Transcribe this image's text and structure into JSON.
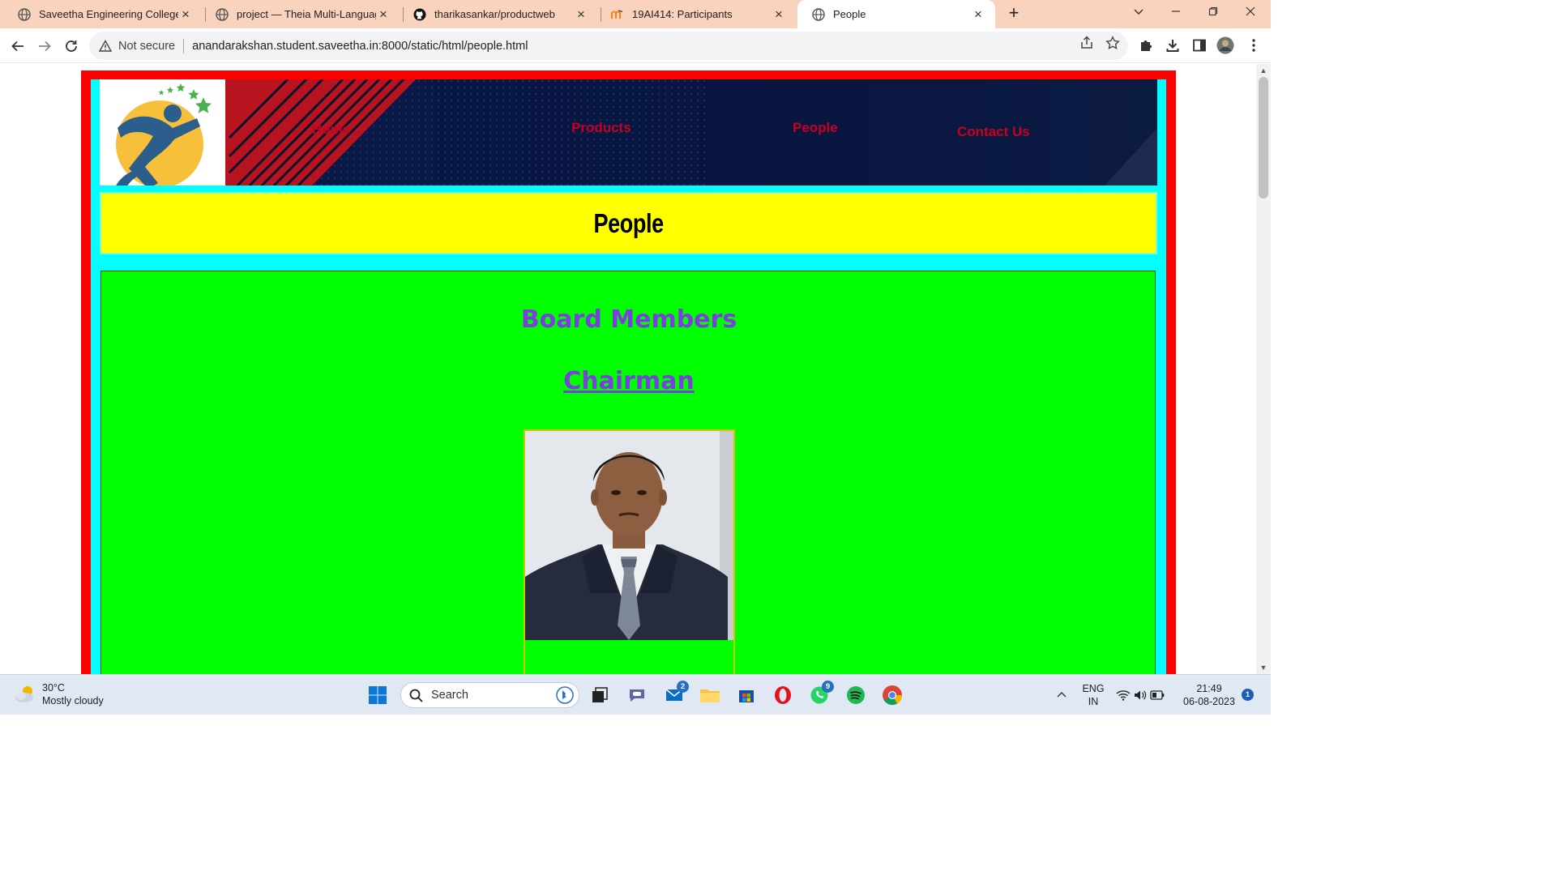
{
  "browser": {
    "tabs": [
      {
        "title": "Saveetha Engineering College",
        "icon": "globe-icon",
        "active": false
      },
      {
        "title": "project — Theia Multi-Language",
        "icon": "globe-icon",
        "active": false
      },
      {
        "title": "tharikasankar/productweb",
        "icon": "github-icon",
        "active": false
      },
      {
        "title": "19AI414: Participants",
        "icon": "moodle-icon",
        "active": false
      },
      {
        "title": "People",
        "icon": "globe-icon",
        "active": true
      }
    ],
    "close_glyph": "×",
    "new_tab_glyph": "+",
    "security_label": "Not secure",
    "url": "anandarakshan.student.saveetha.in:8000/static/html/people.html"
  },
  "page": {
    "nav": {
      "home": "Home",
      "products": "Products",
      "people": "People",
      "contact": "Contact Us"
    },
    "title": "People",
    "board_heading": "Board Members",
    "chairman_heading": "Chairman"
  },
  "taskbar": {
    "weather_temp": "30°C",
    "weather_desc": "Mostly cloudy",
    "search_label": "Search",
    "mail_badge": "2",
    "whatsapp_badge": "9",
    "lang_top": "ENG",
    "lang_bottom": "IN",
    "time": "21:49",
    "date": "06-08-2023",
    "notification_count": "1"
  },
  "colors": {
    "tab_strip": "#f9d3bd",
    "outer_frame": "#ff0000",
    "inner_frame": "#00ffff",
    "title_bar": "#ffff00",
    "content_bg": "#00ff00",
    "heading_text": "#7b3fe0",
    "nav_text": "#c8001f"
  }
}
